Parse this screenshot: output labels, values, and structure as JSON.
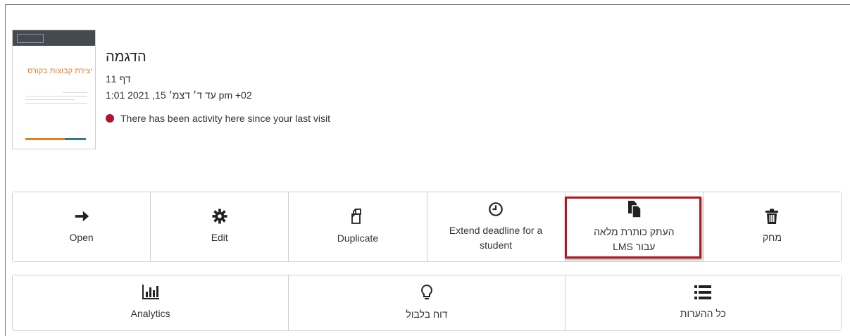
{
  "document": {
    "title": "הדגמה",
    "pages": "דף 11",
    "deadline": "1:01 2021 ,15 עד ד׳ דצמ׳ pm +02",
    "activity_text": "There has been activity here since your last visit",
    "thumbnail_title": "יצירת קבוצות בקורס"
  },
  "actions_row1": [
    {
      "id": "open",
      "label": "Open",
      "icon": "arrow-right-icon"
    },
    {
      "id": "edit",
      "label": "Edit",
      "icon": "gear-icon"
    },
    {
      "id": "duplicate",
      "label": "Duplicate",
      "icon": "copy-icon"
    },
    {
      "id": "extend",
      "label": "Extend deadline for a student",
      "icon": "clock-icon"
    },
    {
      "id": "copy-lms",
      "label": "העתק כותרת מלאה עבור LMS",
      "icon": "document-copy-icon"
    },
    {
      "id": "delete",
      "label": "מחק",
      "icon": "trash-icon"
    }
  ],
  "actions_row2": [
    {
      "id": "analytics",
      "label": "Analytics",
      "icon": "bar-chart-icon"
    },
    {
      "id": "confusion-report",
      "label": "דוח בלבול",
      "icon": "lightbulb-icon"
    },
    {
      "id": "all-comments",
      "label": "כל ההערות",
      "icon": "list-icon"
    }
  ],
  "colors": {
    "activity_dot": "#b3132b",
    "highlight": "#b1171e",
    "thumb_accent": "#e47d24"
  }
}
